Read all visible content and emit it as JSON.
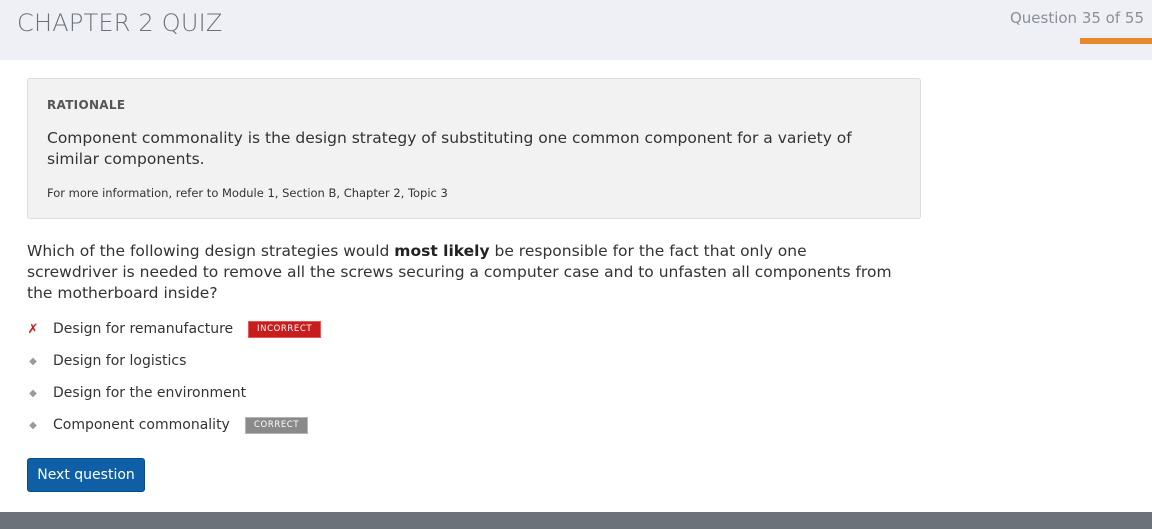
{
  "header": {
    "title": "CHAPTER 2 QUIZ",
    "progress_label": "Question 35 of 55",
    "progress_fraction": 0.636
  },
  "rationale": {
    "heading": "RATIONALE",
    "body": "Component commonality is the design strategy of substituting one common component for a variety of similar components.",
    "reference": "For more information, refer to Module 1, Section B, Chapter 2, Topic 3"
  },
  "question": {
    "text_before": "Which of the following design strategies would ",
    "text_bold": "most likely",
    "text_after": " be responsible for the fact that only one screwdriver is needed to remove all the screws securing a computer case and to unfasten all components from the motherboard inside?"
  },
  "options": [
    {
      "label": "Design for remanufacture",
      "badge": "INCORRECT"
    },
    {
      "label": "Design for logistics",
      "badge": ""
    },
    {
      "label": "Design for the environment",
      "badge": ""
    },
    {
      "label": "Component commonality",
      "badge": "CORRECT"
    }
  ],
  "next_button_label": "Next question",
  "colors": {
    "accent_orange": "#e8882a",
    "primary_blue": "#0e5fa6",
    "incorrect_red": "#c81d1d",
    "correct_gray": "#8a8a8a"
  },
  "icons": {
    "wrong_mark": "x-mark-icon",
    "bullet": "bullet-icon"
  }
}
